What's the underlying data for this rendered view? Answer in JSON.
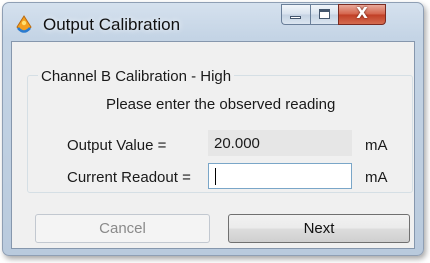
{
  "window": {
    "title": "Output Calibration",
    "icon": "calibration-app-icon",
    "controls": {
      "minimize": "minimize-icon",
      "maximize": "maximize-icon",
      "close": "close-icon",
      "close_glyph": "X"
    }
  },
  "group": {
    "title": "Channel B Calibration - High",
    "instruction": "Please enter the observed reading"
  },
  "fields": {
    "output_value": {
      "label": "Output Value =",
      "value": "20.000",
      "unit": "mA"
    },
    "current_readout": {
      "label": "Current Readout =",
      "value": "",
      "unit": "mA"
    }
  },
  "buttons": {
    "cancel": "Cancel",
    "next": "Next"
  },
  "colors": {
    "title_bar": "#c4d4e5",
    "close_button": "#c13f26",
    "client_background": "#f0f0f0",
    "disabled_text": "#8a8a8a",
    "input_focus_border": "#7aa6c8"
  }
}
